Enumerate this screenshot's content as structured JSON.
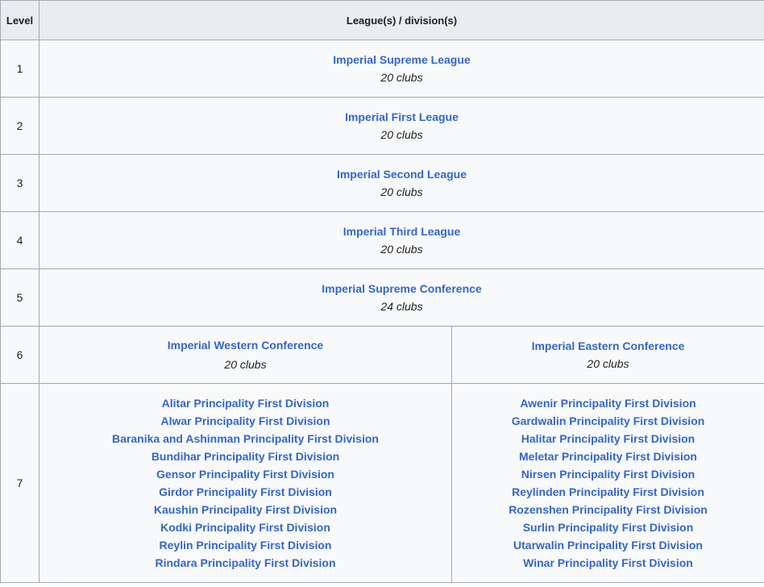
{
  "header": {
    "level": "Level",
    "leagues": "League(s) / division(s)"
  },
  "rows": [
    {
      "level": "1",
      "name": "Imperial Supreme League",
      "clubs": "20 clubs"
    },
    {
      "level": "2",
      "name": "Imperial First League",
      "clubs": "20 clubs"
    },
    {
      "level": "3",
      "name": "Imperial Second League",
      "clubs": "20 clubs"
    },
    {
      "level": "4",
      "name": "Imperial Third League",
      "clubs": "20 clubs"
    },
    {
      "level": "5",
      "name": "Imperial Supreme Conference",
      "clubs": "24 clubs"
    }
  ],
  "row6": {
    "level": "6",
    "west": {
      "name": "Imperial Western Conference",
      "clubs": "20 clubs"
    },
    "east": {
      "name": "Imperial Eastern Conference",
      "clubs": "20 clubs"
    }
  },
  "row7": {
    "level": "7",
    "west": [
      "Alitar Principality First Division",
      "Alwar Principality First Division",
      "Baranika and Ashinman Principality First Division",
      "Bundihar Principality First Division",
      "Gensor Principality First Division",
      "Girdor Principality First Division",
      "Kaushin Principality First Division",
      "Kodki Principality First Division",
      "Reylin Principality First Division",
      "Rindara Principality First Division"
    ],
    "east": [
      "Awenir Principality First Division",
      "Gardwalin Principality First Division",
      "Halitar Principality First Division",
      "Meletar Principality First Division",
      "Nirsen Principality First Division",
      "Reylinden Principality First Division",
      "Rozenshen Principality First Division",
      "Surlin Principality First Division",
      "Utarwalin Principality First Division",
      "Winar Principality First Division"
    ]
  },
  "colors": {
    "link": "#3366cc",
    "header_bg": "#eaecf0",
    "cell_bg": "#f8f9fa",
    "border": "#a2a9b1"
  }
}
